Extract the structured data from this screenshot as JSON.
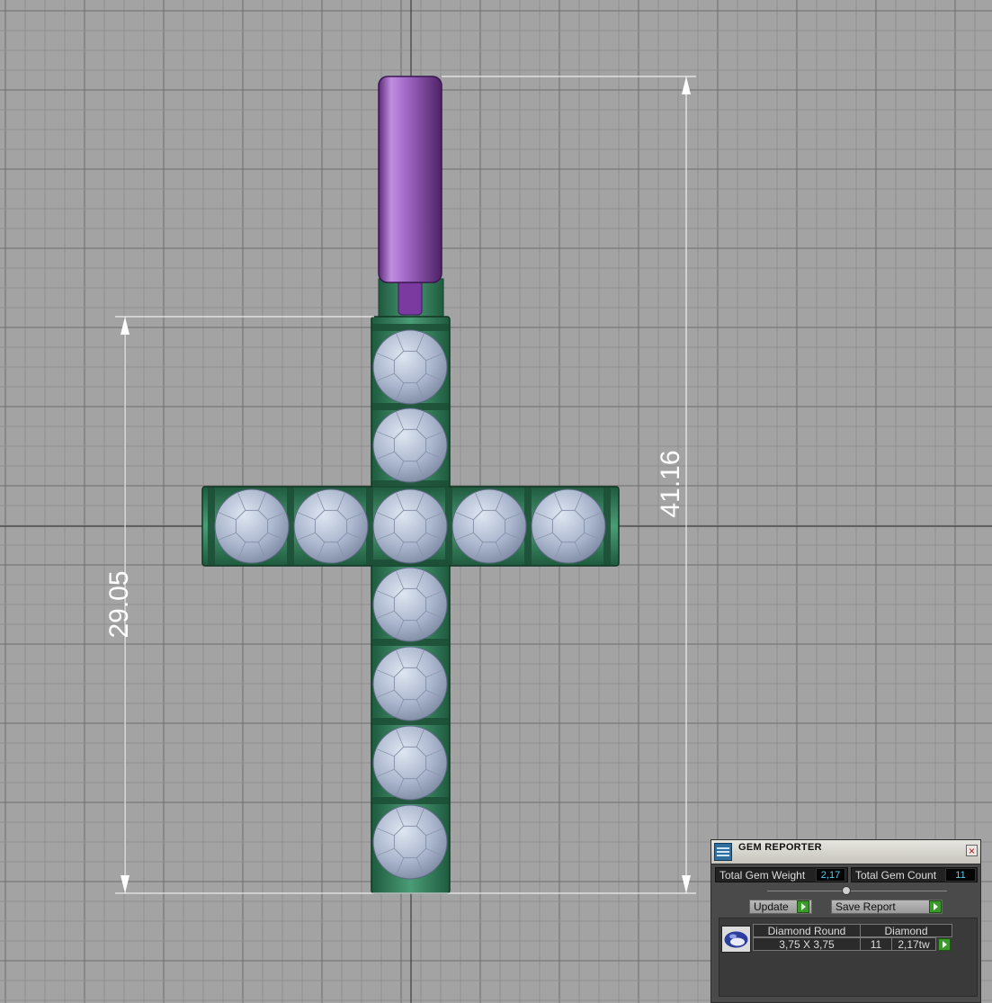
{
  "viewport": {
    "dimension_vertical_left": "29.05",
    "dimension_vertical_right": "41.16"
  },
  "gem_reporter": {
    "title": "GEM REPORTER",
    "close_glyph": "×",
    "total_gem_weight_label": "Total Gem Weight",
    "total_gem_weight_value": "2,17",
    "total_gem_count_label": "Total Gem Count",
    "total_gem_count_value": "11",
    "update_label": "Update",
    "save_report_label": "Save Report",
    "gems": [
      {
        "shape": "Diamond Round",
        "size": "3,75 X 3,75",
        "material": "Diamond",
        "count": "11",
        "weight": "2,17tw"
      }
    ]
  },
  "colors": {
    "background": "#a3a3a3",
    "grid_minor": "#8f8f8f",
    "grid_major": "#6e6e6e",
    "bail": "#8e44b4",
    "metal": "#2f7a58",
    "gem": "#a9b6cc",
    "accent_value": "#4fd0f0",
    "play_button": "#3c9a2c"
  }
}
